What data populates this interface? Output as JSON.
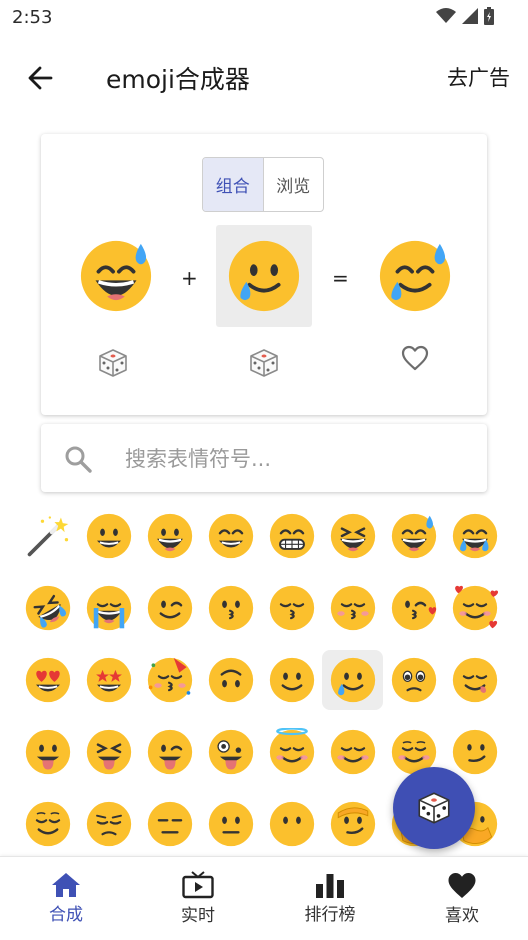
{
  "status": {
    "time": "2:53"
  },
  "appbar": {
    "title": "emoji合成器",
    "ad_label": "去广告"
  },
  "combo": {
    "tabs": [
      {
        "label": "组合",
        "active": true
      },
      {
        "label": "浏览",
        "active": false
      }
    ],
    "left_emoji": "grinning-sweat",
    "right_emoji": "smiling-face-with-tear",
    "plus": "+",
    "equals": "=",
    "result": "mashup-grinning-sweat-tear"
  },
  "search": {
    "placeholder": "搜索表情符号..."
  },
  "emoji_rows": [
    [
      "magic-wand",
      "grinning",
      "smiley",
      "smile",
      "grin",
      "laughing",
      "sweat-smile",
      "joy"
    ],
    [
      "rofl",
      "sob",
      "wink",
      "kissing",
      "kissing-smiling-eyes",
      "kissing-closed-eyes",
      "kissing-heart",
      "smiling-hearts"
    ],
    [
      "heart-eyes",
      "star-struck",
      "partying",
      "upside-down",
      "slight-smile",
      "smiling-tear",
      "pleading",
      "yum"
    ],
    [
      "tongue",
      "squint-tongue",
      "wink-tongue",
      "zany",
      "halo",
      "blush",
      "relaxed",
      "smirk"
    ],
    [
      "relieved",
      "pensive",
      "expressionless",
      "neutral",
      "no-mouth",
      "saluting",
      "hand-over-mouth",
      "hand-over-mouth-2"
    ]
  ],
  "selected_cell": "smiling-tear",
  "nav": [
    {
      "label": "合成",
      "icon": "home-icon",
      "active": true
    },
    {
      "label": "实时",
      "icon": "tv-icon",
      "active": false
    },
    {
      "label": "排行榜",
      "icon": "bar-chart-icon",
      "active": false
    },
    {
      "label": "喜欢",
      "icon": "heart-icon",
      "active": false
    }
  ],
  "colors": {
    "primary": "#3f51b5",
    "fab": "#3f4fb4",
    "emoji_yellow": "#fbc02d"
  }
}
